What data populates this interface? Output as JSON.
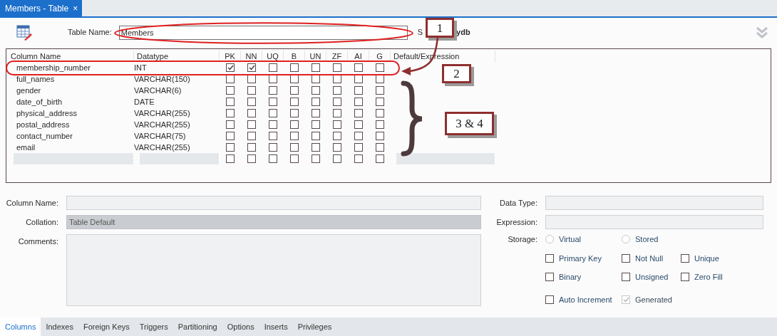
{
  "document_tab": {
    "title": "Members - Table",
    "close": "×"
  },
  "header": {
    "table_name_label": "Table Name:",
    "table_name": "Members",
    "schema_label": "S",
    "schema_value": "ydb"
  },
  "columns": [
    {
      "kind": "text",
      "label": "Column Name"
    },
    {
      "kind": "text",
      "label": "Datatype"
    },
    {
      "kind": "flag",
      "label": "PK"
    },
    {
      "kind": "flag",
      "label": "NN"
    },
    {
      "kind": "flag",
      "label": "UQ"
    },
    {
      "kind": "flag",
      "label": "B"
    },
    {
      "kind": "flag",
      "label": "UN"
    },
    {
      "kind": "flag",
      "label": "ZF"
    },
    {
      "kind": "flag",
      "label": "AI"
    },
    {
      "kind": "flag",
      "label": "G"
    },
    {
      "kind": "text",
      "label": "Default/Expression"
    }
  ],
  "rows": [
    {
      "kind": "column",
      "name": "membership_number",
      "datatype": "INT",
      "flags": [
        true,
        true,
        false,
        false,
        false,
        false,
        false,
        false
      ]
    },
    {
      "kind": "column",
      "name": "full_names",
      "datatype": "VARCHAR(150)",
      "flags": [
        false,
        false,
        false,
        false,
        false,
        false,
        false,
        false
      ]
    },
    {
      "kind": "column",
      "name": "gender",
      "datatype": "VARCHAR(6)",
      "flags": [
        false,
        false,
        false,
        false,
        false,
        false,
        false,
        false
      ]
    },
    {
      "kind": "column",
      "name": "date_of_birth",
      "datatype": "DATE",
      "flags": [
        false,
        false,
        false,
        false,
        false,
        false,
        false,
        false
      ]
    },
    {
      "kind": "column",
      "name": "physical_address",
      "datatype": "VARCHAR(255)",
      "flags": [
        false,
        false,
        false,
        false,
        false,
        false,
        false,
        false
      ]
    },
    {
      "kind": "column",
      "name": "postal_address",
      "datatype": "VARCHAR(255)",
      "flags": [
        false,
        false,
        false,
        false,
        false,
        false,
        false,
        false
      ]
    },
    {
      "kind": "column",
      "name": "contact_number",
      "datatype": "VARCHAR(75)",
      "flags": [
        false,
        false,
        false,
        false,
        false,
        false,
        false,
        false
      ]
    },
    {
      "kind": "column",
      "name": "email",
      "datatype": "VARCHAR(255)",
      "flags": [
        false,
        false,
        false,
        false,
        false,
        false,
        false,
        false
      ]
    },
    {
      "kind": "new",
      "flags": [
        false,
        false,
        false,
        false,
        false,
        false,
        false,
        false
      ]
    }
  ],
  "details": {
    "left": [
      {
        "kind": "input",
        "label": "Column Name:"
      },
      {
        "kind": "select",
        "label": "Collation:",
        "value": "Table Default"
      },
      {
        "kind": "textarea",
        "label": "Comments:"
      }
    ],
    "right": [
      {
        "kind": "input",
        "label": "Data Type:"
      },
      {
        "kind": "input",
        "label": "Expression:"
      }
    ],
    "storage": {
      "label": "Storage:",
      "options": [
        {
          "label": "Virtual",
          "selected": false
        },
        {
          "label": "Stored",
          "selected": false
        }
      ]
    },
    "option_rows": [
      [
        {
          "label": "Primary Key",
          "checked": false,
          "disabled": false
        },
        {
          "label": "Not Null",
          "checked": false,
          "disabled": false
        },
        {
          "label": "Unique",
          "checked": false,
          "disabled": false
        }
      ],
      [
        {
          "label": "Binary",
          "checked": false,
          "disabled": false
        },
        {
          "label": "Unsigned",
          "checked": false,
          "disabled": false
        },
        {
          "label": "Zero Fill",
          "checked": false,
          "disabled": false
        }
      ],
      [
        {
          "label": "Auto Increment",
          "checked": false,
          "disabled": false
        },
        {
          "label": "Generated",
          "checked": true,
          "disabled": true
        }
      ]
    ]
  },
  "bottom_tabs": [
    {
      "label": "Columns",
      "selected": true
    },
    {
      "label": "Indexes",
      "selected": false
    },
    {
      "label": "Foreign Keys",
      "selected": false
    },
    {
      "label": "Triggers",
      "selected": false
    },
    {
      "label": "Partitioning",
      "selected": false
    },
    {
      "label": "Options",
      "selected": false
    },
    {
      "label": "Inserts",
      "selected": false
    },
    {
      "label": "Privileges",
      "selected": false
    }
  ],
  "annotations": [
    {
      "kind": "callout",
      "text": "1"
    },
    {
      "kind": "callout",
      "text": "2"
    },
    {
      "kind": "callout",
      "text": "3 & 4"
    },
    {
      "kind": "ellipse"
    },
    {
      "kind": "ellipse"
    },
    {
      "kind": "arrow"
    },
    {
      "kind": "brace"
    }
  ]
}
